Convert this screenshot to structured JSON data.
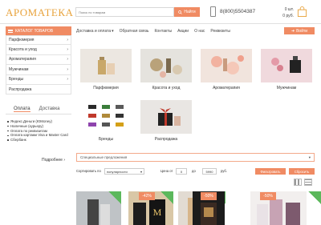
{
  "header": {
    "logo": "АРОМАТЕКА N1",
    "search_placeholder": "Поиск по товарам",
    "search_button": "Найти",
    "phone": "8(800)5504387",
    "cart_count": "0 шт.",
    "cart_sum": "0 руб."
  },
  "nav": {
    "catalog_button": "КАТАЛОГ ТОВАРОВ",
    "items": [
      "Доставка и оплата",
      "Обратная связь",
      "Контакты",
      "Акции",
      "О нас",
      "Реквизиты"
    ],
    "login_button": "Войти"
  },
  "sidebar": {
    "items": [
      {
        "label": "Парфюмерия",
        "has_children": true
      },
      {
        "label": "Красота и уход",
        "has_children": true
      },
      {
        "label": "Ароматерапия",
        "has_children": true
      },
      {
        "label": "Мужчинам",
        "has_children": true
      },
      {
        "label": "Бренды",
        "has_children": true
      },
      {
        "label": "Распродажа",
        "has_children": false
      }
    ],
    "tabs": [
      "Оплата",
      "Доставка"
    ],
    "payment_methods": [
      "Яндекс.Деньги (ЮMoney)",
      "Наличные (курьеру)",
      "Оплата по реквизитам",
      "Оплата картами Visa и Master Card",
      "Сбербанк"
    ],
    "more_link": "Подробнее"
  },
  "categories": [
    {
      "label": "Парфюмерия",
      "icon": "perfume-bottle"
    },
    {
      "label": "Красота и уход",
      "icon": "cosmetics"
    },
    {
      "label": "Ароматерапия",
      "icon": "aroma-flowers"
    },
    {
      "label": "Мужчинам",
      "icon": "mens-perfume"
    },
    {
      "label": "Бренды",
      "icon": "brand-logos"
    },
    {
      "label": "Распродажа",
      "icon": "gift-box"
    }
  ],
  "specials": {
    "label": "Специальные предложения"
  },
  "sorting": {
    "sort_label": "Сортировать по",
    "sort_value": "популярности",
    "price_label": "Цена от",
    "price_from": "0",
    "price_to_label": "до",
    "price_to": "5990",
    "currency": "руб.",
    "filter_button": "Фильтровать",
    "reset_button": "Сбросить"
  },
  "products": [
    {
      "badge": ""
    },
    {
      "badge": "-42%"
    },
    {
      "badge": ""
    },
    {
      "badge": "-50%"
    },
    {
      "badge": "-50%"
    }
  ],
  "colors": {
    "accent": "#f08b63",
    "logo": "#e8a33d",
    "ribbon": "#5cb85c"
  }
}
